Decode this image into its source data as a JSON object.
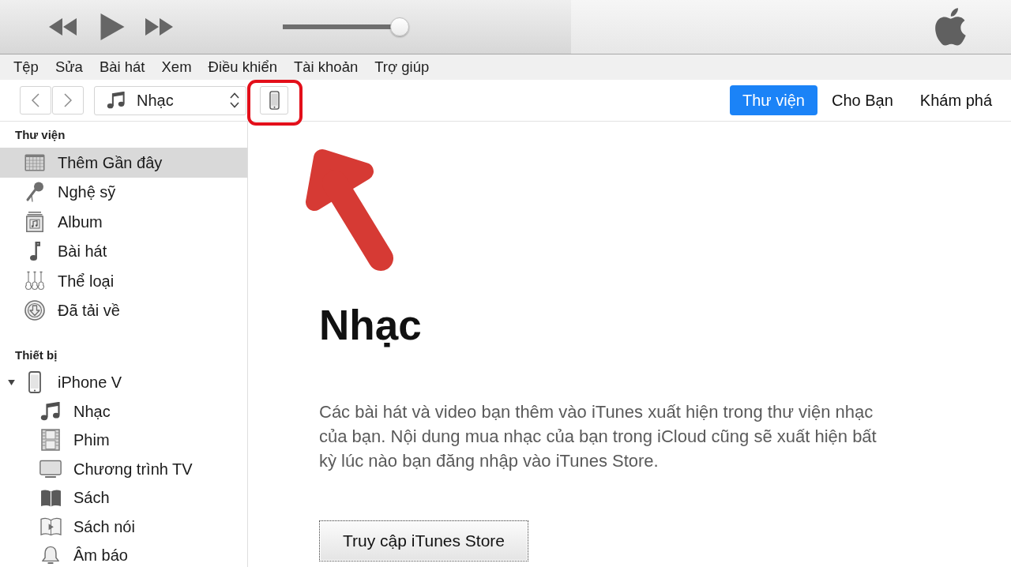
{
  "player": {
    "volume": {
      "level": 1
    }
  },
  "menu": [
    "Tệp",
    "Sửa",
    "Bài hát",
    "Xem",
    "Điều khiển",
    "Tài khoản",
    "Trợ giúp"
  ],
  "toolbar": {
    "media_picker": {
      "value": "Nhạc"
    },
    "tabs": [
      {
        "label": "Thư viện",
        "selected": true
      },
      {
        "label": "Cho Bạn",
        "selected": false
      },
      {
        "label": "Khám phá",
        "selected": false
      }
    ]
  },
  "sidebar": {
    "sections": [
      {
        "heading": "Thư viện",
        "items": [
          {
            "label": "Thêm Gần đây",
            "selected": true
          },
          {
            "label": "Nghệ sỹ",
            "selected": false
          },
          {
            "label": "Album",
            "selected": false
          },
          {
            "label": "Bài hát",
            "selected": false
          },
          {
            "label": "Thể loại",
            "selected": false
          },
          {
            "label": "Đã tải về",
            "selected": false
          }
        ]
      },
      {
        "heading": "Thiết bị",
        "items": [
          {
            "label": "iPhone V",
            "selected": false,
            "expanded": true,
            "children": [
              {
                "label": "Nhạc",
                "selected": false
              },
              {
                "label": "Phim",
                "selected": false
              },
              {
                "label": "Chương trình TV",
                "selected": false
              },
              {
                "label": "Sách",
                "selected": false
              },
              {
                "label": "Sách nói",
                "selected": false
              },
              {
                "label": "Âm báo",
                "selected": false
              }
            ]
          }
        ]
      }
    ]
  },
  "main": {
    "title": "Nhạc",
    "description": "Các bài hát và video bạn thêm vào iTunes xuất hiện trong thư viện nhạc của bạn. Nội dung mua nhạc của bạn trong iCloud cũng sẽ xuất hiện bất kỳ lúc nào bạn đăng nhập vào iTunes Store.",
    "button": "Truy cập iTunes Store"
  }
}
